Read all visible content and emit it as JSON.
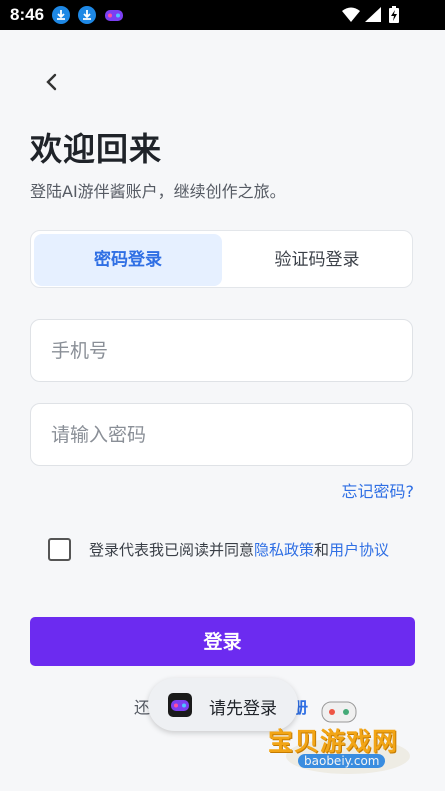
{
  "status_bar": {
    "time": "8:46",
    "icons": [
      "download-icon",
      "download-icon",
      "game-app-icon",
      "wifi-icon",
      "signal-icon",
      "battery-charging-icon"
    ]
  },
  "nav": {
    "back_icon": "chevron-left-icon"
  },
  "header": {
    "title": "欢迎回来",
    "subtitle": "登陆AI游伴酱账户，继续创作之旅。"
  },
  "tabs": [
    {
      "label": "密码登录",
      "active": true
    },
    {
      "label": "验证码登录",
      "active": false
    }
  ],
  "form": {
    "phone_placeholder": "手机号",
    "phone_value": "",
    "password_placeholder": "请输入密码",
    "password_value": "",
    "forgot_label": "忘记密码?"
  },
  "agreement": {
    "checked": false,
    "prefix": "登录代表我已阅读并同意",
    "privacy_link": "隐私政策",
    "and": "和",
    "user_link": "用户协议"
  },
  "login_button": "登录",
  "bottom": {
    "prefix": "还",
    "suffix": "册"
  },
  "toast": {
    "text": "请先登录"
  },
  "watermark": {
    "text": "宝贝游戏网",
    "url": "baobeiy.com"
  },
  "colors": {
    "accent": "#6c2bf0",
    "link": "#2f6fe4",
    "tab_active_bg": "#e6f0ff"
  }
}
